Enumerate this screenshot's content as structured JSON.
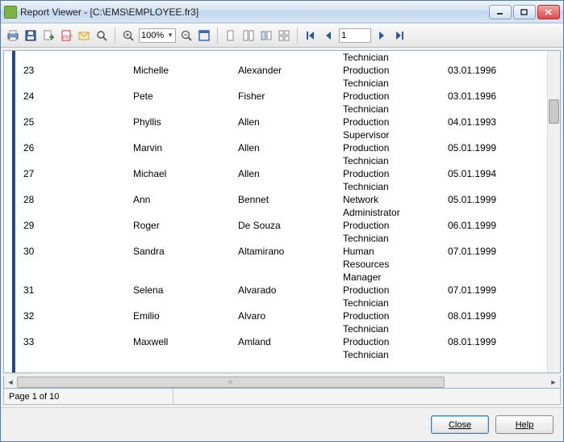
{
  "window": {
    "title": "Report Viewer - [C:\\EMS\\EMPLOYEE.fr3]"
  },
  "toolbar": {
    "zoom": "100%",
    "page_input": "1"
  },
  "report": {
    "partial_top_job_line2": "Technician",
    "rows": [
      {
        "num": "23",
        "first": "Michelle",
        "last": "Alexander",
        "job": [
          "Production",
          "Technician"
        ],
        "date": "03.01.1996"
      },
      {
        "num": "24",
        "first": "Pete",
        "last": "Fisher",
        "job": [
          "Production",
          "Technician"
        ],
        "date": "03.01.1996"
      },
      {
        "num": "25",
        "first": "Phyllis",
        "last": "Allen",
        "job": [
          "Production",
          "Supervisor"
        ],
        "date": "04.01.1993"
      },
      {
        "num": "26",
        "first": "Marvin",
        "last": "Allen",
        "job": [
          "Production",
          "Technician"
        ],
        "date": "05.01.1999"
      },
      {
        "num": "27",
        "first": "Michael",
        "last": "Allen",
        "job": [
          "Production",
          "Technician"
        ],
        "date": "05.01.1994"
      },
      {
        "num": "28",
        "first": "Ann",
        "last": "Bennet",
        "job": [
          "Network",
          "Administrator"
        ],
        "date": "05.01.1999"
      },
      {
        "num": "29",
        "first": "Roger",
        "last": "De Souza",
        "job": [
          "Production",
          "Technician"
        ],
        "date": "06.01.1999"
      },
      {
        "num": "30",
        "first": "Sandra",
        "last": "Altamirano",
        "job": [
          "Human",
          "Resources",
          "Manager"
        ],
        "date": "07.01.1999"
      },
      {
        "num": "31",
        "first": "Selena",
        "last": "Alvarado",
        "job": [
          "Production",
          "Technician"
        ],
        "date": "07.01.1999"
      },
      {
        "num": "32",
        "first": "Emilio",
        "last": "Alvaro",
        "job": [
          "Production",
          "Technician"
        ],
        "date": "08.01.1999"
      },
      {
        "num": "33",
        "first": "Maxwell",
        "last": "Amland",
        "job": [
          "Production",
          "Technician"
        ],
        "date": "08.01.1999"
      }
    ]
  },
  "status": {
    "page_text": "Page 1 of 10"
  },
  "footer": {
    "close_label": "Close",
    "help_label": "Help"
  }
}
